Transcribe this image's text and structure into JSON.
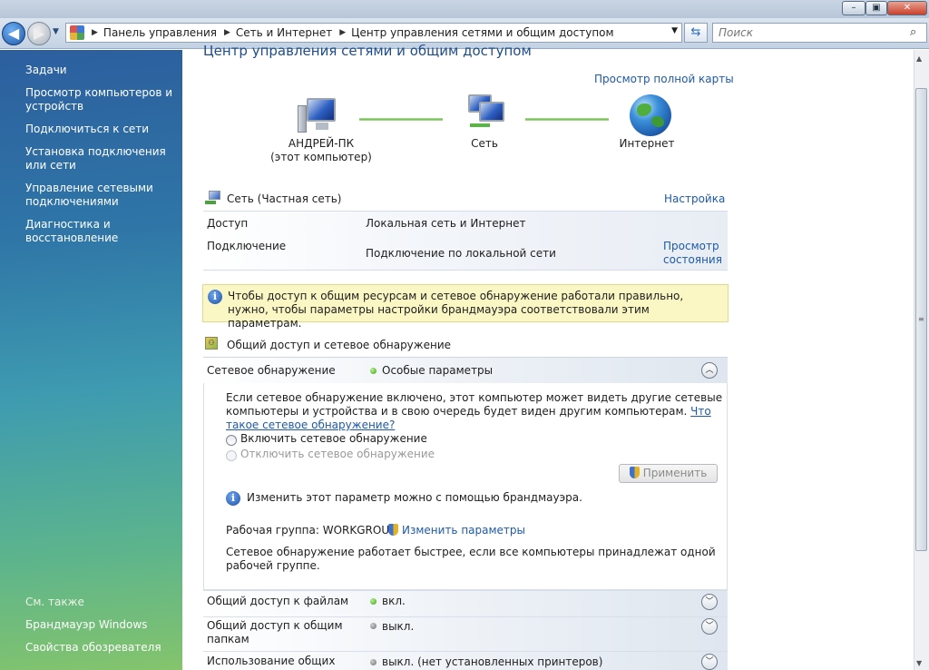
{
  "address": {
    "crumbs": [
      "Панель управления",
      "Сеть и Интернет",
      "Центр управления сетями и общим доступом"
    ]
  },
  "search": {
    "placeholder": "Поиск"
  },
  "sidebar": {
    "heading": "Задачи",
    "tasks": [
      "Просмотр компьютеров и устройств",
      "Подключиться к сети",
      "Установка подключения или сети",
      "Управление сетевыми подключениями",
      "Диагностика и восстановление"
    ],
    "see_also_heading": "См. также",
    "see_also": [
      "Брандмауэр Windows",
      "Свойства обозревателя"
    ]
  },
  "main": {
    "title": "Центр управления сетями и общим доступом",
    "full_map_link": "Просмотр полной карты",
    "map": {
      "computer_name": "АНДРЕЙ-ПК",
      "computer_sub": "(этот компьютер)",
      "network_label": "Сеть",
      "internet_label": "Интернет"
    },
    "network": {
      "header": "Сеть (Частная сеть)",
      "settings_link": "Настройка",
      "access_label": "Доступ",
      "access_value": "Локальная сеть и Интернет",
      "connection_label": "Подключение",
      "connection_value": "Подключение по локальной сети",
      "view_status_link_1": "Просмотр",
      "view_status_link_2": "состояния"
    },
    "banner": {
      "text": "Чтобы доступ к общим ресурсам и сетевое обнаружение работали правильно, нужно, чтобы параметры настройки брандмауэра соответствовали этим параметрам."
    },
    "sharing": {
      "heading": "Общий доступ и сетевое обнаружение",
      "discovery": {
        "label": "Сетевое обнаружение",
        "status": "Особые параметры",
        "description": "Если сетевое обнаружение включено, этот компьютер может видеть другие сетевые компьютеры и устройства и в свою очередь будет виден другим компьютерам.",
        "what_is_link": "Что такое сетевое обнаружение?",
        "option_on": "Включить сетевое обнаружение",
        "option_off": "Отключить сетевое обнаружение",
        "apply_button": "Применить",
        "firewall_note": "Изменить этот параметр можно с помощью брандмауэра.",
        "workgroup_label": "Рабочая группа: WORKGROUP",
        "change_settings_link": "Изменить параметры",
        "workgroup_note": "Сетевое обнаружение работает быстрее, если все компьютеры принадлежат одной рабочей группе."
      },
      "file_sharing": {
        "label": "Общий доступ к файлам",
        "status": "вкл."
      },
      "public_folders": {
        "label_1": "Общий доступ к общим",
        "label_2": "папкам",
        "status": "выкл."
      },
      "printers": {
        "label": "Использование общих",
        "status": "выкл. (нет установленных принтеров)"
      }
    }
  },
  "colors": {
    "link": "#1e5aa8",
    "status_on": "#3b9e1a",
    "status_off": "#6d6d6d",
    "banner_bg": "#fbf7c4"
  }
}
